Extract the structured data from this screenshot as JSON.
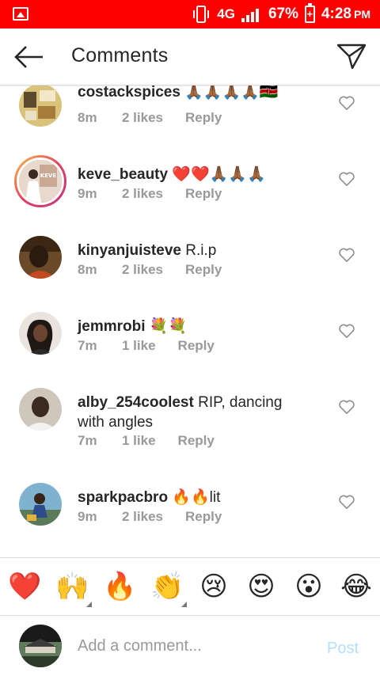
{
  "status_bar": {
    "network": "4G",
    "battery": "67%",
    "time": "4:28",
    "ampm": "PM",
    "bg_color": "#ff0000"
  },
  "header": {
    "title": "Comments",
    "back_icon": "arrow-left-icon",
    "send_icon": "paper-plane-icon"
  },
  "comments": [
    {
      "username": "costackspices",
      "text": "🙏🏾🙏🏾🙏🏾🙏🏾🇰🇪",
      "time": "8m",
      "likes": "2 likes",
      "reply": "Reply"
    },
    {
      "username": "keve_beauty",
      "text": "❤️❤️🙏🏾🙏🏾🙏🏾",
      "time": "9m",
      "likes": "2 likes",
      "reply": "Reply"
    },
    {
      "username": "kinyanjuisteve",
      "text": "R.i.p",
      "time": "8m",
      "likes": "2 likes",
      "reply": "Reply"
    },
    {
      "username": "jemmrobi",
      "text": "💐💐",
      "time": "7m",
      "likes": "1 like",
      "reply": "Reply"
    },
    {
      "username": "alby_254coolest",
      "text": "RIP, dancing with angles",
      "time": "7m",
      "likes": "1 like",
      "reply": "Reply"
    },
    {
      "username": "sparkpacbro",
      "text": "🔥🔥lit",
      "time": "9m",
      "likes": "2 likes",
      "reply": "Reply"
    }
  ],
  "emoji_bar": [
    "❤️",
    "🙌",
    "🔥",
    "👏",
    "😢",
    "😍",
    "😮",
    "😂"
  ],
  "composer": {
    "placeholder": "Add a comment...",
    "post_label": "Post",
    "post_color": "#b2dffc"
  }
}
